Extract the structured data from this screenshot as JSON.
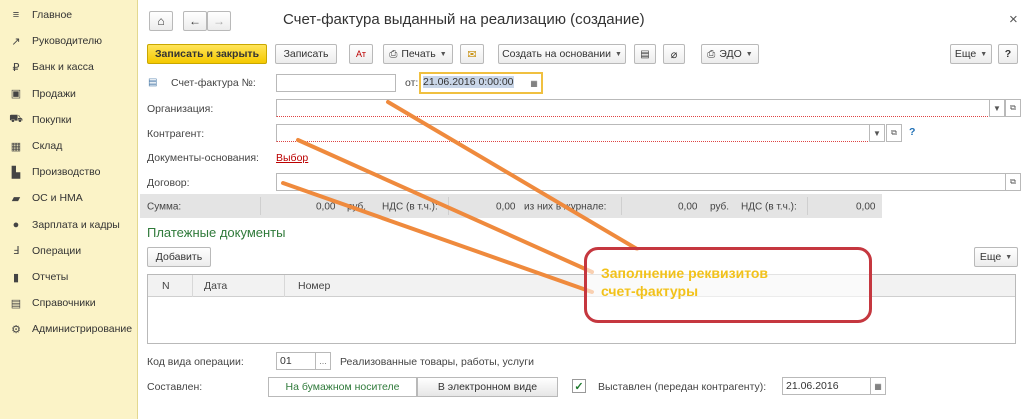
{
  "sidebar": {
    "items": [
      {
        "label": "Главное",
        "icon": "menu-icon",
        "glyph": "≡"
      },
      {
        "label": "Руководителю",
        "icon": "trend-icon",
        "glyph": "↗"
      },
      {
        "label": "Банк и касса",
        "icon": "coin-icon",
        "glyph": "₽"
      },
      {
        "label": "Продажи",
        "icon": "bag-icon",
        "glyph": "▣"
      },
      {
        "label": "Покупки",
        "icon": "cart-icon",
        "glyph": "⛟"
      },
      {
        "label": "Склад",
        "icon": "warehouse-icon",
        "glyph": "▦"
      },
      {
        "label": "Производство",
        "icon": "factory-icon",
        "glyph": "▙"
      },
      {
        "label": "ОС и НМА",
        "icon": "truck-icon",
        "glyph": "▰"
      },
      {
        "label": "Зарплата и кадры",
        "icon": "people-icon",
        "glyph": "●"
      },
      {
        "label": "Операции",
        "icon": "operations-icon",
        "glyph": "Ⅎ"
      },
      {
        "label": "Отчеты",
        "icon": "chart-icon",
        "glyph": "▮"
      },
      {
        "label": "Справочники",
        "icon": "book-icon",
        "glyph": "▤"
      },
      {
        "label": "Администрирование",
        "icon": "gear-icon",
        "glyph": "⚙"
      }
    ]
  },
  "header": {
    "title": "Счет-фактура выданный на реализацию (создание)",
    "close": "×",
    "home_glyph": "⌂",
    "back_glyph": "←",
    "forward_glyph": "→"
  },
  "toolbar": {
    "save_close": "Записать и закрыть",
    "save": "Записать",
    "print": "Печать",
    "create_based": "Создать на основании",
    "edo": "ЭДО",
    "more": "Еще"
  },
  "form": {
    "invoice_label": "Счет-фактура №:",
    "invoice_number": "",
    "from_label": "от:",
    "date_value": "21.06.2016  0:00:00",
    "org_label": "Организация:",
    "org_value": "",
    "contractor_label": "Контрагент:",
    "contractor_value": "",
    "help": "?",
    "docs_label": "Документы-основания:",
    "docs_link": "Выбор",
    "contract_label": "Договор:",
    "contract_value": ""
  },
  "sums": {
    "sum_label": "Сумма:",
    "sum_value": "0,00",
    "currency1": "руб.",
    "vat_label1": "НДС (в т.ч.):",
    "vat_value1": "0,00",
    "journal_label": "из них в журнале:",
    "journal_value": "0,00",
    "currency2": "руб.",
    "vat_label2": "НДС (в т.ч.):",
    "vat_value2": "0,00"
  },
  "payments": {
    "heading": "Платежные документы",
    "add": "Добавить",
    "more": "Еще",
    "columns": [
      "N",
      "Дата",
      "Номер"
    ]
  },
  "footer": {
    "op_code_label": "Код вида операции:",
    "op_code_value": "01",
    "op_code_desc": "Реализованные товары, работы, услуги",
    "composed_label": "Составлен:",
    "paper": "На бумажном носителе",
    "electronic": "В электронном виде",
    "issued_label": "Выставлен (передан контрагенту):",
    "issued_checked": true,
    "issued_date": "21.06.2016"
  },
  "annotation": {
    "line1": "Заполнение реквизитов",
    "line2": "счет-фактуры",
    "arrow_color": "#ef8a3d",
    "box_color": "#c5373f",
    "text_color": "#f2c21b"
  }
}
